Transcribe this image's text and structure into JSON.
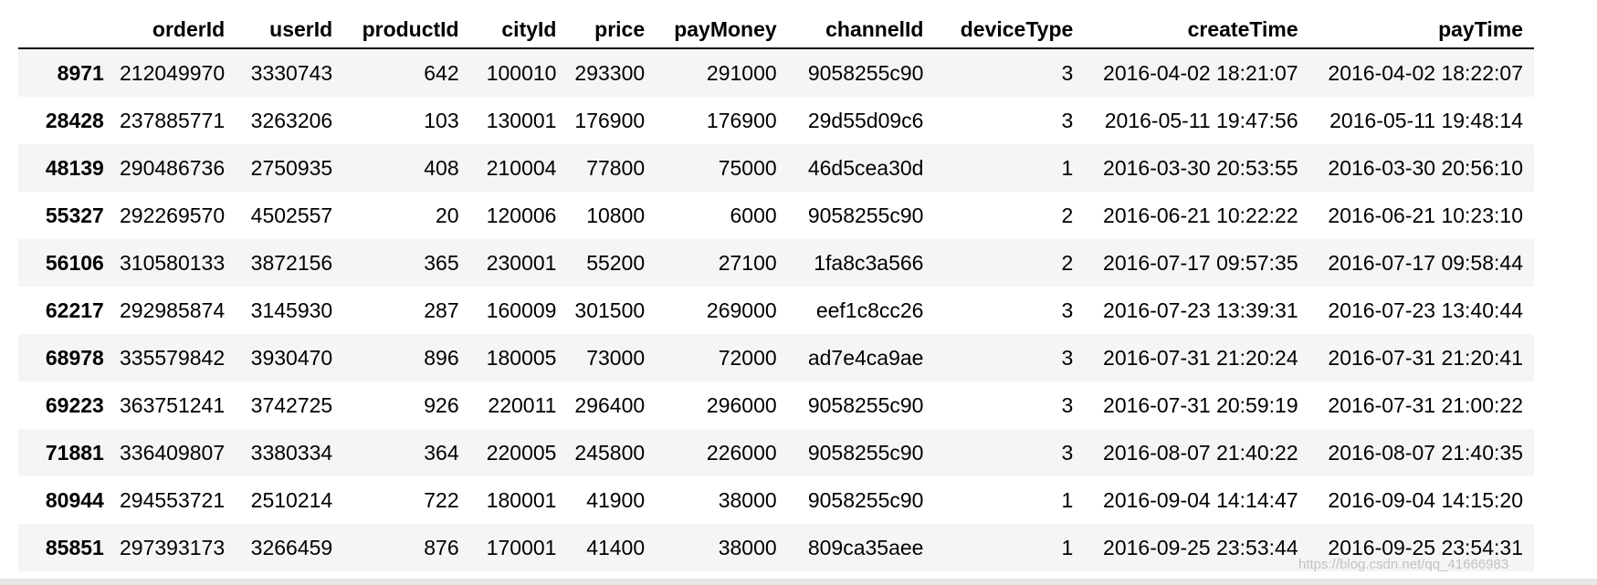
{
  "table": {
    "columns": [
      "",
      "orderId",
      "userId",
      "productId",
      "cityId",
      "price",
      "payMoney",
      "channelId",
      "deviceType",
      "createTime",
      "payTime"
    ],
    "rows": [
      [
        "8971",
        "212049970",
        "3330743",
        "642",
        "100010",
        "293300",
        "291000",
        "9058255c90",
        "3",
        "2016-04-02 18:21:07",
        "2016-04-02 18:22:07"
      ],
      [
        "28428",
        "237885771",
        "3263206",
        "103",
        "130001",
        "176900",
        "176900",
        "29d55d09c6",
        "3",
        "2016-05-11 19:47:56",
        "2016-05-11 19:48:14"
      ],
      [
        "48139",
        "290486736",
        "2750935",
        "408",
        "210004",
        "77800",
        "75000",
        "46d5cea30d",
        "1",
        "2016-03-30 20:53:55",
        "2016-03-30 20:56:10"
      ],
      [
        "55327",
        "292269570",
        "4502557",
        "20",
        "120006",
        "10800",
        "6000",
        "9058255c90",
        "2",
        "2016-06-21 10:22:22",
        "2016-06-21 10:23:10"
      ],
      [
        "56106",
        "310580133",
        "3872156",
        "365",
        "230001",
        "55200",
        "27100",
        "1fa8c3a566",
        "2",
        "2016-07-17 09:57:35",
        "2016-07-17 09:58:44"
      ],
      [
        "62217",
        "292985874",
        "3145930",
        "287",
        "160009",
        "301500",
        "269000",
        "eef1c8cc26",
        "3",
        "2016-07-23 13:39:31",
        "2016-07-23 13:40:44"
      ],
      [
        "68978",
        "335579842",
        "3930470",
        "896",
        "180005",
        "73000",
        "72000",
        "ad7e4ca9ae",
        "3",
        "2016-07-31 21:20:24",
        "2016-07-31 21:20:41"
      ],
      [
        "69223",
        "363751241",
        "3742725",
        "926",
        "220011",
        "296400",
        "296000",
        "9058255c90",
        "3",
        "2016-07-31 20:59:19",
        "2016-07-31 21:00:22"
      ],
      [
        "71881",
        "336409807",
        "3380334",
        "364",
        "220005",
        "245800",
        "226000",
        "9058255c90",
        "3",
        "2016-08-07 21:40:22",
        "2016-08-07 21:40:35"
      ],
      [
        "80944",
        "294553721",
        "2510214",
        "722",
        "180001",
        "41900",
        "38000",
        "9058255c90",
        "1",
        "2016-09-04 14:14:47",
        "2016-09-04 14:15:20"
      ],
      [
        "85851",
        "297393173",
        "3266459",
        "876",
        "170001",
        "41400",
        "38000",
        "809ca35aee",
        "1",
        "2016-09-25 23:53:44",
        "2016-09-25 23:54:31"
      ]
    ]
  },
  "watermark": "https://blog.csdn.net/qq_41666983"
}
